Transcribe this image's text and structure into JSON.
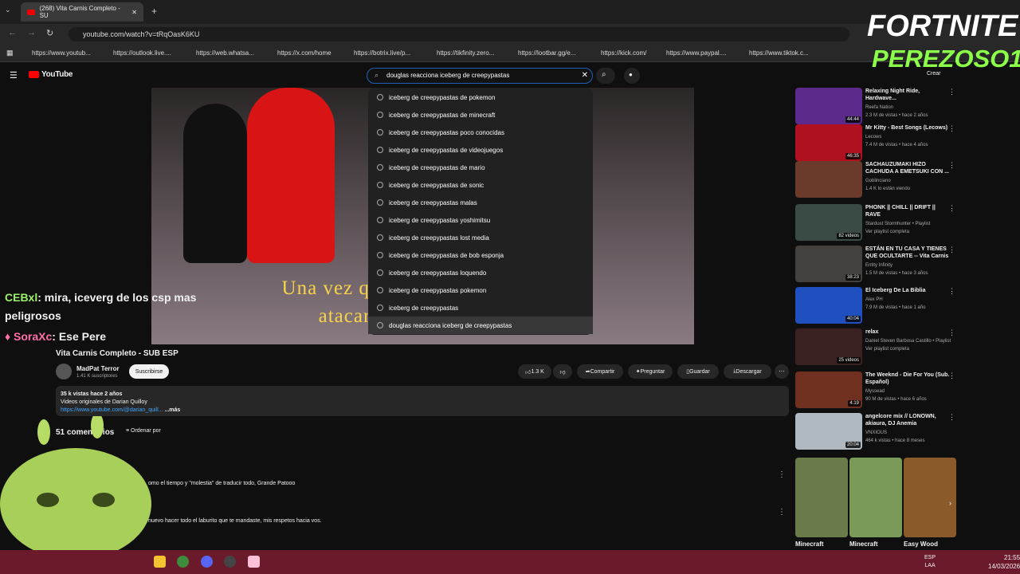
{
  "browser": {
    "tab_title": "(268) Vita Carnis Completo - SU",
    "url": "youtube.com/watch?v=tRqOasK6KU",
    "bookmarks": [
      "https://www.youtub...",
      "https://outlook.live....",
      "https://web.whatsa...",
      "https://x.com/home",
      "https://botrix.live/p...",
      "https://tikfinity.zero...",
      "https://lootbar.gg/e...",
      "https://kick.com/",
      "https://www.paypal....",
      "https://www.tiktok.c..."
    ]
  },
  "header": {
    "logo": "YouTube",
    "search_value": "douglas reacciona iceberg de creepypastas",
    "create": "Crear"
  },
  "suggestions": [
    "iceberg de creepypastas de pokemon",
    "iceberg de creepypastas de minecraft",
    "iceberg de creepypastas poco conocidas",
    "iceberg de creepypastas de videojuegos",
    "iceberg de creepypastas de mario",
    "iceberg de creepypastas de sonic",
    "iceberg de creepypastas malas",
    "iceberg de creepypastas yoshimitsu",
    "iceberg de creepypastas lost media",
    "iceberg de creepypastas de bob esponja",
    "iceberg de creepypastas loquendo",
    "iceberg de creepypastas pokemon",
    "iceberg de creepypastas",
    "douglas reacciona iceberg de creepypastas"
  ],
  "video": {
    "caption_line1": "Una vez que un huma                          el mímico",
    "caption_line2": "atacará rápidame                          fenso-",
    "title": "Vita Carnis Completo - SUB ESP"
  },
  "chat": [
    {
      "user": "CEBxl",
      "text": ": mira, iceverg de los csp mas peligrosos"
    },
    {
      "user": "SoraXc",
      "text": ": Ese Pere"
    }
  ],
  "channel": {
    "name": "MadPat Terror",
    "subs": "1.41 K suscriptores",
    "subscribe": "Suscribirse"
  },
  "actions": {
    "likes": "1.3 K",
    "share": "Compartir",
    "ask": "Preguntar",
    "save": "Guardar",
    "download": "Descargar"
  },
  "description": {
    "meta": "35 k vistas  hace 2 años",
    "line": "Videos originales de Darian Quilloy",
    "link": "https://www.youtube.com/@darian_quill...",
    "more": "...más"
  },
  "comments": {
    "count": "51 comentarios",
    "sort": "Ordenar por",
    "c1": "omo el tiempo y \"molestia\" de traducir todo, Grande Patooo",
    "c2": "nuevo hacer todo el laburito que te mandaste, mis respetos hacia vos."
  },
  "recommended": [
    {
      "title": "Relaxing Night Ride, Hardwave...",
      "channel": "Reefa Nation",
      "meta": "2.3 M de vistas • hace 2 años",
      "dur": "44:44",
      "color": "#5b2a8a"
    },
    {
      "title": "Mr Kitty - Best Songs (Lecows)",
      "channel": "Lecows",
      "meta": "7.4 M de vistas • hace 4 años",
      "dur": "46:35",
      "color": "#b01020"
    },
    {
      "title": "SACHAUZUMAKI HIZO CACHUDA A EMETSUKI CON ...",
      "channel": "Goblinciano",
      "meta": "1.4 K lo están viendo",
      "dur": "",
      "color": "#6a3a2a"
    },
    {
      "title": "PHONK || CHILL || DRIFT || RAVE",
      "channel": "Stardust Stormhunter • Playlist",
      "meta": "Ver playlist completa",
      "dur": "82 videos",
      "color": "#3a4a44"
    },
    {
      "title": "ESTÁN EN TU CASA Y TIENES QUE OCULTARTE -- Vita Carnis",
      "channel": "Entity Infinity",
      "meta": "1.5 M de vistas • hace 3 años",
      "dur": "38:23",
      "color": "#44403e"
    },
    {
      "title": "El Iceberg De La Biblia",
      "channel": "Alex PH",
      "meta": "7.9 M de vistas • hace 1 año",
      "dur": "40:04",
      "color": "#2050c0"
    },
    {
      "title": "relax",
      "channel": "Daniel Steven Barbosa Castillo • Playlist",
      "meta": "Ver playlist completa",
      "dur": "25 videos",
      "color": "#3a2020"
    },
    {
      "title": "The Weeknd - Die For You (Sub. Español)",
      "channel": "Myssead",
      "meta": "90 M de vistas • hace 6 años",
      "dur": "4:19",
      "color": "#703020"
    },
    {
      "title": "angelcore mix // LONOWN, akiaura, DJ Anemia",
      "channel": "VNXIOUS",
      "meta": "464 k vistas • hace 8 meses",
      "dur": "20:04",
      "color": "#b0b8c0"
    }
  ],
  "shorts": [
    "Minecraft",
    "Minecraft",
    "Easy Wood"
  ],
  "overlay": {
    "line1": "FORTNITE",
    "line2": "PEREZOSO1"
  },
  "taskbar": {
    "lang1": "ESP",
    "lang2": "LAA",
    "time": "21:55",
    "date": "14/03/2026"
  }
}
